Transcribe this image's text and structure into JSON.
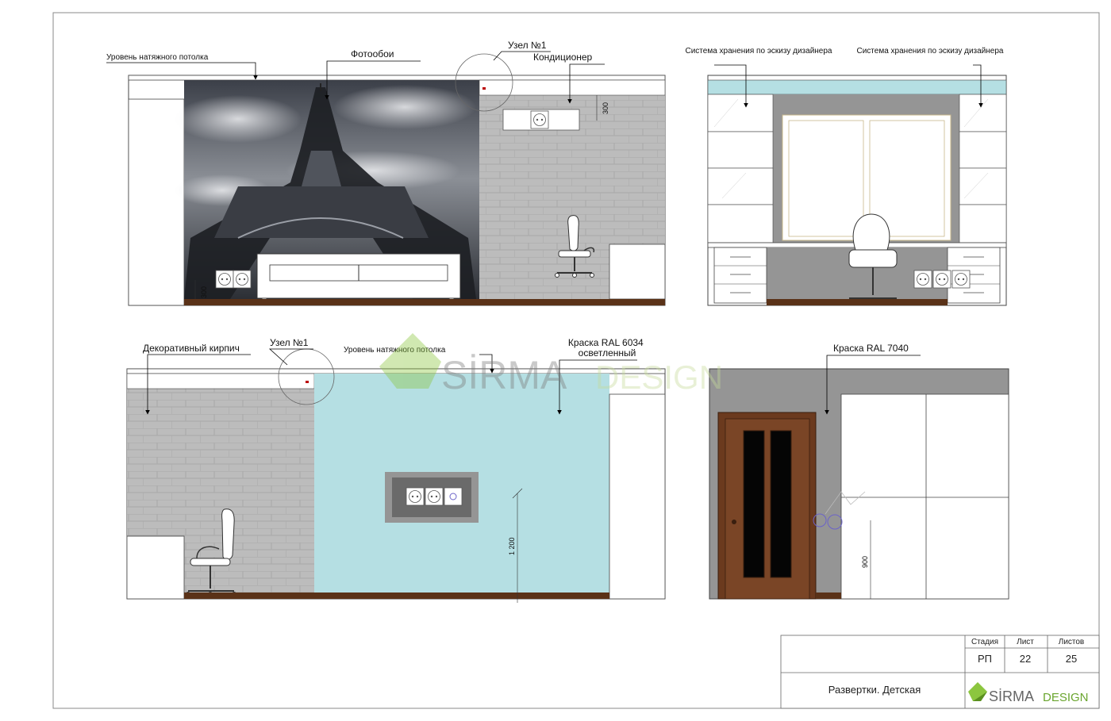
{
  "annotations": {
    "ceiling_level_1": "Уровень натяжного потолка",
    "photo_wallpaper": "Фотообои",
    "node_1_top": "Узел №1",
    "air_conditioner": "Кондиционер",
    "storage_left": "Система хранения по эскизу дизайнера",
    "storage_right": "Система хранения по эскизу дизайнера",
    "decorative_brick": "Декоративный кирпич",
    "node_1_bottom": "Узел №1",
    "ceiling_level_2": "Уровень натяжного потолка",
    "paint_ral_6034_line1": "Краска RAL 6034",
    "paint_ral_6034_line2": "осветленный",
    "paint_ral_7040": "Краска RAL 7040"
  },
  "dimensions": {
    "ac_height": "300",
    "socket_height": "300",
    "tv_socket_height": "1 200",
    "switch_height": "900"
  },
  "title_block": {
    "col_stage": "Стадия",
    "col_sheet": "Лист",
    "col_sheets": "Листов",
    "stage": "РП",
    "sheet": "22",
    "sheets": "25",
    "title": "Развертки. Детская",
    "logo_part1": "SİRMA",
    "logo_part2": "DESIGN"
  },
  "watermark": {
    "part1": "SİRMA",
    "part2": "DESIGN"
  },
  "colors": {
    "brick": "#bcbcbc",
    "mint_paint": "#b5dfe3",
    "grey_paint": "#959595",
    "floor": "#5a3218",
    "door": "#6b3a1e",
    "logo_green": "#8cc63f"
  }
}
